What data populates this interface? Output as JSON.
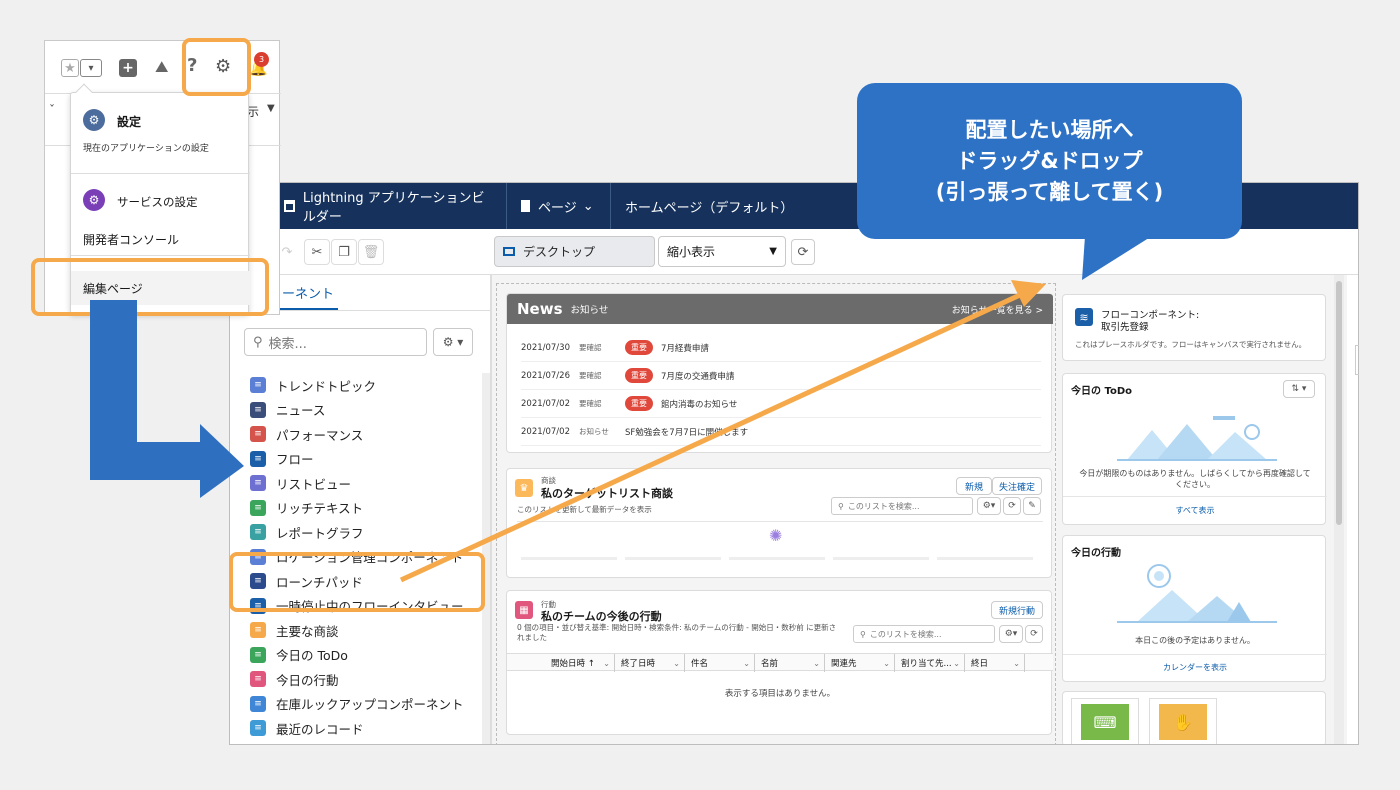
{
  "builder": {
    "topbar": {
      "app_title": "Lightning アプリケーションビルダー",
      "page_menu": "ページ",
      "page_name": "ホームページ（デフォルト）"
    },
    "toolbar": {
      "device": "デスクトップ",
      "zoom": "縮小表示"
    },
    "left_panel": {
      "tab_label": "ーネント",
      "search_placeholder": "検索...",
      "components": [
        {
          "label": "トレンドトピック",
          "icon": "list-icon",
          "color": "#5b7fd4"
        },
        {
          "label": "ニュース",
          "icon": "news-icon",
          "color": "#3b4e79"
        },
        {
          "label": "パフォーマンス",
          "icon": "performance-icon",
          "color": "#d4544b"
        },
        {
          "label": "フロー",
          "icon": "flow-icon",
          "color": "#1b5fa8"
        },
        {
          "label": "リストビュー",
          "icon": "listview-icon",
          "color": "#6d6fd1"
        },
        {
          "label": "リッチテキスト",
          "icon": "richtext-icon",
          "color": "#3ba55c"
        },
        {
          "label": "レポートグラフ",
          "icon": "report-chart-icon",
          "color": "#3aa1a3"
        },
        {
          "label": "ロケーション管理コンポーネント",
          "icon": "location-icon",
          "color": "#5b7fd4"
        },
        {
          "label": "ローンチパッド",
          "icon": "launchpad-icon",
          "color": "#2b4b8c"
        },
        {
          "label": "一時停止中のフローインタビュー",
          "icon": "paused-flow-icon",
          "color": "#1b5fa8"
        },
        {
          "label": "主要な商談",
          "icon": "opportunity-icon",
          "color": "#f6a94a"
        },
        {
          "label": "今日の ToDo",
          "icon": "todo-icon",
          "color": "#3ba55c"
        },
        {
          "label": "今日の行動",
          "icon": "event-icon",
          "color": "#e0567d"
        },
        {
          "label": "在庫ルックアップコンポーネント",
          "icon": "inventory-icon",
          "color": "#3f86d6"
        },
        {
          "label": "最近のレコード",
          "icon": "recent-icon",
          "color": "#3f9bd6"
        }
      ]
    },
    "news": {
      "title": "News",
      "subtitle": "お知らせ",
      "link": "お知らせ一覧を見る >",
      "rows": [
        {
          "date": "2021/07/30",
          "status": "要確認",
          "badge": "重要",
          "text": "7月経費申請"
        },
        {
          "date": "2021/07/26",
          "status": "要確認",
          "badge": "重要",
          "text": "7月度の交通費申請"
        },
        {
          "date": "2021/07/02",
          "status": "要確認",
          "badge": "重要",
          "text": "館内消毒のお知らせ"
        },
        {
          "date": "2021/07/02",
          "status": "お知らせ",
          "badge": "",
          "text": "SF勉強会を7月7日に開催します"
        }
      ]
    },
    "opp": {
      "object": "商談",
      "title": "私のターゲットリスト商談",
      "subtitle": "このリストを更新して最新データを表示",
      "btn_new": "新規",
      "btn_close": "失注確定",
      "search": "このリストを検索..."
    },
    "activity": {
      "object": "行動",
      "title": "私のチームの今後の行動",
      "subtitle": "0 個の項目・並び替え基準: 開始日時・検索条件: 私のチームの行動 - 開始日・数秒前 に更新されました",
      "btn_new": "新規行動",
      "search": "このリストを検索...",
      "columns": [
        "開始日時 ↑",
        "終了日時",
        "件名",
        "名前",
        "関連先",
        "割り当て先...",
        "終日"
      ],
      "empty": "表示する項目はありません。"
    },
    "flow": {
      "title": "フローコンポーネント:",
      "name": "取引先登録",
      "placeholder": "これはプレースホルダです。フローはキャンバスで実行されません。"
    },
    "todo": {
      "title": "今日の ToDo",
      "empty": "今日が期限のものはありません。しばらくしてから再度確認してください。",
      "link": "すべて表示"
    },
    "events": {
      "title": "今日の行動",
      "empty": "本日この後の予定はありません。",
      "link": "カレンダーを表示"
    }
  },
  "menu": {
    "notification_count": "3",
    "partial_text": "示",
    "setup_title": "設定",
    "setup_desc": "現在のアプリケーションの設定",
    "service_setup": "サービスの設定",
    "dev_console": "開発者コンソール",
    "edit_page": "編集ページ"
  },
  "callout": {
    "line1": "配置したい場所へ",
    "line2": "ドラッグ&ドロップ",
    "line3": "(引っ張って離して置く)"
  },
  "colors": {
    "accent_orange": "#f6a94a",
    "callout_blue": "#2e72c6",
    "arrow_blue": "#2f6fc0",
    "topbar_navy": "#16325c",
    "badge_red": "#e1483c"
  }
}
